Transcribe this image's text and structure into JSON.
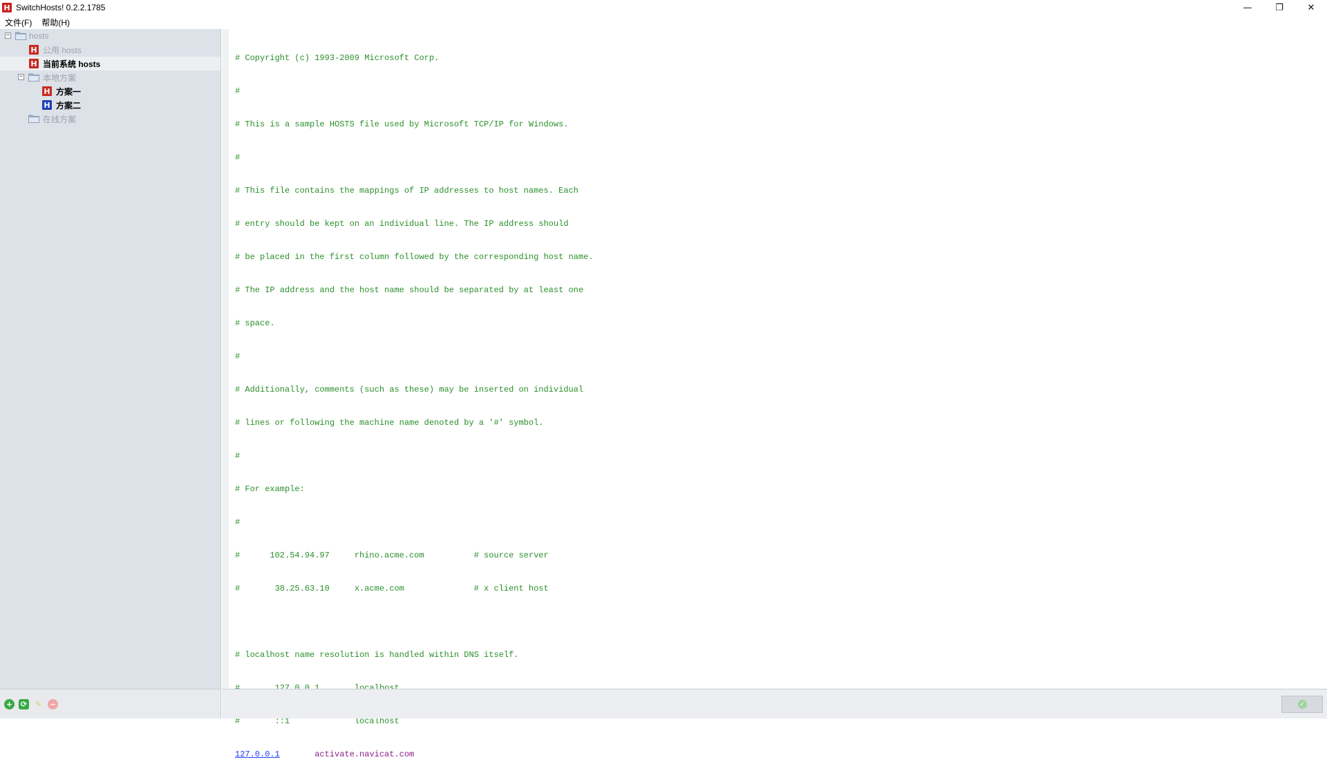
{
  "window": {
    "title": "SwitchHosts! 0.2.2.1785",
    "app_icon_letter": "H",
    "controls": {
      "minimize": "—",
      "restore": "❐",
      "close": "✕"
    }
  },
  "menu": {
    "items": [
      "文件(F)",
      "帮助(H)"
    ]
  },
  "sidebar": {
    "root": {
      "label": "hosts",
      "toggle": "−"
    },
    "common_hosts": {
      "label": "公用 hosts"
    },
    "current_system_hosts": {
      "label": "当前系统 hosts"
    },
    "local_group": {
      "label": "本地方案",
      "toggle": "−"
    },
    "scheme_one": {
      "label": "方案一"
    },
    "scheme_two": {
      "label": "方案二"
    },
    "online_group": {
      "label": "在线方案"
    }
  },
  "editor": {
    "lines": [
      "# Copyright (c) 1993-2009 Microsoft Corp.",
      "#",
      "# This is a sample HOSTS file used by Microsoft TCP/IP for Windows.",
      "#",
      "# This file contains the mappings of IP addresses to host names. Each",
      "# entry should be kept on an individual line. The IP address should",
      "# be placed in the first column followed by the corresponding host name.",
      "# The IP address and the host name should be separated by at least one",
      "# space.",
      "#",
      "# Additionally, comments (such as these) may be inserted on individual",
      "# lines or following the machine name denoted by a '#' symbol.",
      "#",
      "# For example:",
      "#",
      "#      102.54.94.97     rhino.acme.com          # source server",
      "#       38.25.63.10     x.acme.com              # x client host",
      "",
      "# localhost name resolution is handled within DNS itself.",
      "#       127.0.0.1       localhost",
      "#       ::1             localhost"
    ],
    "entry": {
      "ip": "127.0.0.1",
      "gap": "       ",
      "domain": "activate.navicat.com"
    }
  },
  "toolbar": {
    "add_icon": "+",
    "refresh_icon": "⟳",
    "edit_icon": "✎",
    "delete_icon": "−",
    "apply_icon": "✓"
  }
}
